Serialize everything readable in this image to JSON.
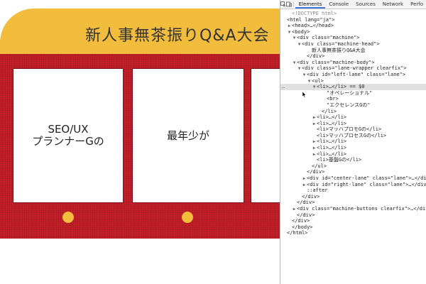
{
  "machine": {
    "title": "新人事無茶振りQ&A大会",
    "cards": [
      {
        "line1": "SEO/UX",
        "line2": "プランナーGの"
      },
      {
        "line1": "最年少が",
        "line2": ""
      }
    ],
    "colors": {
      "head": "#f2bd3c",
      "body": "#c8202a",
      "dot": "#f2bd3c"
    }
  },
  "devtools": {
    "tabs": [
      "Elements",
      "Console",
      "Sources",
      "Network",
      "Perfo"
    ],
    "active_tab": "Elements",
    "tree": [
      {
        "text": "<!DOCTYPE html>",
        "dim": true,
        "indent": 1
      },
      {
        "text": "<html lang=\"ja\">",
        "indent": 0
      },
      {
        "text": "<head>…</head>",
        "indent": 1,
        "toggle": "▶"
      },
      {
        "text": "<body>",
        "indent": 1,
        "toggle": "▼"
      },
      {
        "text": "<div class=\"machine\">",
        "indent": 2,
        "toggle": "▼"
      },
      {
        "text": "<div class=\"machine-head\">",
        "indent": 3,
        "toggle": "▼"
      },
      {
        "text": "新人事無茶振りQ&A大会",
        "indent": 5
      },
      {
        "text": "</div>",
        "indent": 4
      },
      {
        "text": "<div class=\"machine-body\">",
        "indent": 2,
        "toggle": "▼"
      },
      {
        "text": "<div class=\"lane-wrapper clearfix\">",
        "indent": 3,
        "toggle": "▼"
      },
      {
        "text": "<div id=\"left-lane\" class=\"lane\">",
        "indent": 4,
        "toggle": "▼"
      },
      {
        "text": "<ul>",
        "indent": 5,
        "toggle": "▼"
      },
      {
        "text": "<li>…</li> == $0",
        "indent": 6,
        "toggle": "▼",
        "selected": true
      },
      {
        "text": "\"オペレーショナル\"",
        "indent": 8
      },
      {
        "text": "<br>",
        "indent": 8
      },
      {
        "text": "\"エクセレンスGの\"",
        "indent": 8
      },
      {
        "text": "</li>",
        "indent": 7
      },
      {
        "text": "<li>…</li>",
        "indent": 6,
        "toggle": "▶"
      },
      {
        "text": "<li>…</li>",
        "indent": 6,
        "toggle": "▶"
      },
      {
        "text": "<li>マッハプロモGの</li>",
        "indent": 6
      },
      {
        "text": "<li>マッハプロセスGの</li>",
        "indent": 6
      },
      {
        "text": "<li>…</li>",
        "indent": 6,
        "toggle": "▶"
      },
      {
        "text": "<li>…</li>",
        "indent": 6,
        "toggle": "▶"
      },
      {
        "text": "<li>…</li>",
        "indent": 6,
        "toggle": "▶"
      },
      {
        "text": "<li>基盤Gの</li>",
        "indent": 6
      },
      {
        "text": "</ul>",
        "indent": 5
      },
      {
        "text": "</div>",
        "indent": 4
      },
      {
        "text": "<div id=\"center-lane\" class=\"lane\">…</div>",
        "indent": 4,
        "toggle": "▶"
      },
      {
        "text": "<div id=\"right-lane\" class=\"lane\">…</div>",
        "indent": 4,
        "toggle": "▶"
      },
      {
        "text": "::after",
        "indent": 4
      },
      {
        "text": "</div>",
        "indent": 3
      },
      {
        "text": "</div>",
        "indent": 2
      },
      {
        "text": "<div class=\"machine-buttons clearfix\">…</div>",
        "indent": 2,
        "toggle": "▶"
      },
      {
        "text": "</div>",
        "indent": 2
      },
      {
        "text": "</div>",
        "indent": 1
      },
      {
        "text": "</body>",
        "indent": 1
      },
      {
        "text": "</html>",
        "indent": 0
      }
    ]
  }
}
